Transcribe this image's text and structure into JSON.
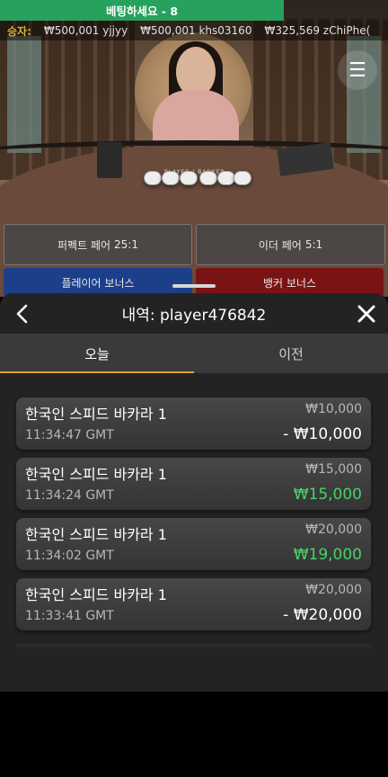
{
  "bet_timer": "베팅하세요 - 8",
  "winners": {
    "label": "승자:",
    "items": [
      "₩500,001 yjjyy",
      "₩500,001 khs03160",
      "₩325,569 zChiPhe("
    ]
  },
  "menu_icon": "hamburger-menu-icon",
  "bets": {
    "perfect_pair": {
      "label": "퍼펙트 페어",
      "odds": "25:1"
    },
    "either_pair": {
      "label": "이더 페어",
      "odds": "5:1"
    },
    "player_bonus": {
      "label": "플레이어 보너스"
    },
    "banker_bonus": {
      "label": "뱅커 보너스"
    }
  },
  "table_labels": {
    "player_banker": "PLAYER | BANKER"
  },
  "history": {
    "title": "내역: player476842",
    "back_icon": "chevron-left-icon",
    "close_icon": "close-icon",
    "tabs": [
      {
        "label": "오늘",
        "active": true
      },
      {
        "label": "이전",
        "active": false
      }
    ],
    "entries": [
      {
        "game": "한국인 스피드 바카라 1",
        "time": "11:34:47 GMT",
        "stake": "₩10,000",
        "amount": "- ₩10,000",
        "result": "loss"
      },
      {
        "game": "한국인 스피드 바카라 1",
        "time": "11:34:24 GMT",
        "stake": "₩15,000",
        "amount": "₩15,000",
        "result": "win"
      },
      {
        "game": "한국인 스피드 바카라 1",
        "time": "11:34:02 GMT",
        "stake": "₩20,000",
        "amount": "₩19,000",
        "result": "win"
      },
      {
        "game": "한국인 스피드 바카라 1",
        "time": "11:33:41 GMT",
        "stake": "₩20,000",
        "amount": "- ₩20,000",
        "result": "loss"
      }
    ]
  },
  "colors": {
    "accent": "#e79d34",
    "win": "#49d26a",
    "timer_bar": "#27a15d"
  }
}
